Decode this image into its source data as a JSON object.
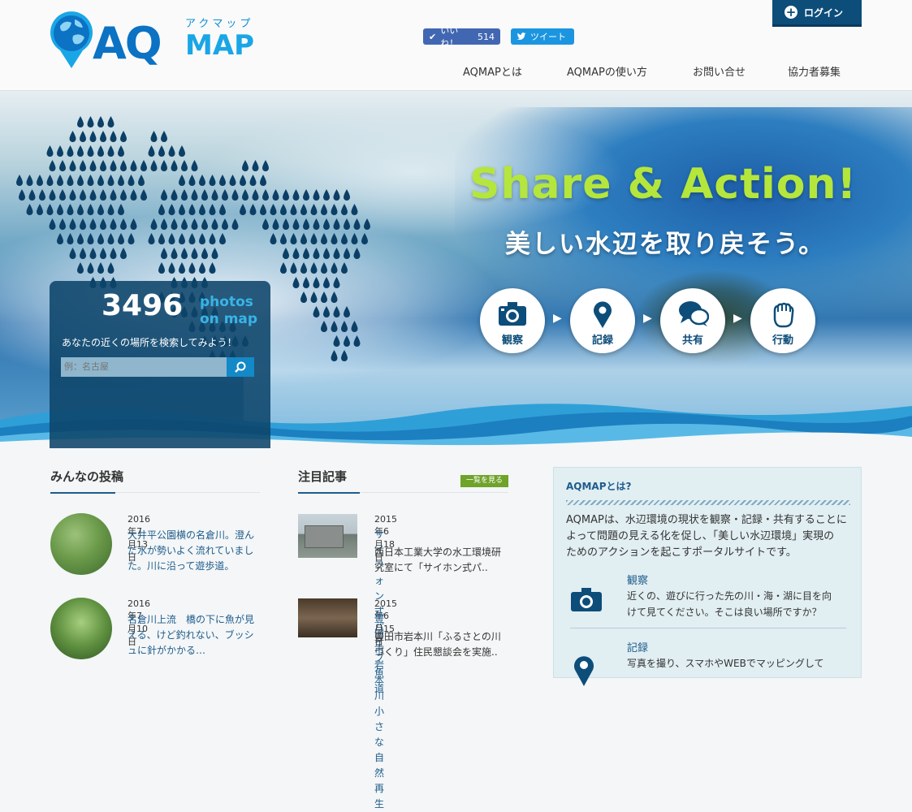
{
  "header": {
    "logo": {
      "kana": "アクマップ",
      "aq": "AQ",
      "map": "MAP"
    },
    "login_label": "ログイン",
    "like": {
      "label": "いいね！",
      "count": "514"
    },
    "tweet_label": "ツイート",
    "nav": [
      "AQMAPとは",
      "AQMAPの使い方",
      "お問い合せ",
      "協力者募集"
    ]
  },
  "hero": {
    "headline": "Share & Action!",
    "subline": "美しい水辺を取り戻そう。",
    "steps": [
      {
        "label": "観察",
        "icon": "camera-icon"
      },
      {
        "label": "記録",
        "icon": "map-pin-icon"
      },
      {
        "label": "共有",
        "icon": "chat-bubbles-icon"
      },
      {
        "label": "行動",
        "icon": "fist-icon"
      }
    ],
    "search": {
      "count": "3496",
      "count_label_1": "photos",
      "count_label_2": "on map",
      "prompt": "あなたの近くの場所を検索してみよう！",
      "placeholder": "例：名古屋"
    }
  },
  "posts": {
    "title": "みんなの投稿",
    "items": [
      {
        "date": "2016年7月13日",
        "title_lines": [
          "大井平公園横の名倉川。澄ん",
          "だ水が勢いよく流れていまし",
          "た。川に沿って遊歩道。"
        ]
      },
      {
        "date": "2016年7月10日",
        "title_lines": [
          "名倉川上流　橋の下に魚が見",
          "える、けど釣れない、ブッシ",
          "ュに針がかかる…"
        ]
      }
    ]
  },
  "articles": {
    "title": "注目記事",
    "see_all": "一覧を見る",
    "items": [
      {
        "date": "2015年6月18日",
        "title": "サイフォン式パイプ魚道",
        "excerpt_lines": [
          "西日本工業大学の水工環境研",
          "究室にて「サイホン式パ.."
        ]
      },
      {
        "date": "2015年6月15日",
        "title": "豊田市岩本川小さな自然再生",
        "excerpt_lines": [
          "豊田市岩本川「ふるさとの川",
          "づくり」住民懇談会を実施.."
        ]
      }
    ]
  },
  "about": {
    "title": "AQMAPとは?",
    "intro_lines": [
      "AQMAPは、水辺環境の現状を観察・記録・共有することに",
      "よって問題の見える化を促し、「美しい水辺環境」実現の",
      "ためのアクションを起こすポータルサイトです。"
    ],
    "items": [
      {
        "title": "観察",
        "desc_lines": [
          "近くの、遊びに行った先の川・海・湖に目を向",
          "けて見てください。そこは良い場所ですか？"
        ]
      },
      {
        "title": "記録",
        "desc_lines": [
          "写真を撮り、スマホやWEBでマッピングして"
        ]
      }
    ]
  },
  "colors": {
    "accent": "#0d4d7a",
    "brand": "#0b72c4",
    "headline": "#b5e63c",
    "link": "#1e5c8c",
    "green": "#6fa32a"
  }
}
